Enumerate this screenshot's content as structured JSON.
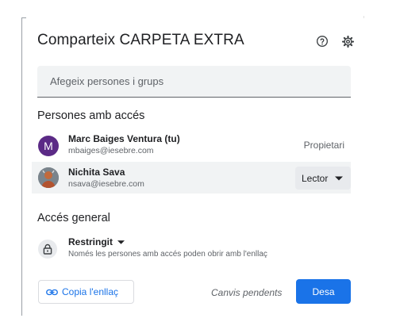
{
  "dialog": {
    "title": "Comparteix CARPETA EXTRA",
    "help_icon": "help-circle-icon",
    "settings_icon": "gear-icon"
  },
  "add_people": {
    "placeholder": "Afegeix persones i grups",
    "value": ""
  },
  "people_section": {
    "title": "Persones amb accés",
    "people": [
      {
        "name": "Marc Baiges Ventura (tu)",
        "email": "mbaiges@iesebre.com",
        "avatar_letter": "M",
        "role": "Propietari"
      },
      {
        "name": "Nichita Sava",
        "email": "nsava@iesebre.com",
        "role": "Lector"
      }
    ]
  },
  "general_access": {
    "title": "Accés general",
    "setting": "Restringit",
    "description": "Només les persones amb accés poden obrir amb l'enllaç",
    "icon": "lock-icon"
  },
  "footer": {
    "copy_link_label": "Copia l'enllaç",
    "copy_icon": "link-icon",
    "pending_text": "Canvis pendents",
    "save_label": "Desa"
  },
  "colors": {
    "accent": "#1a73e8",
    "avatar_bg": "#5b2a86",
    "field_bg": "#f1f3f4"
  }
}
